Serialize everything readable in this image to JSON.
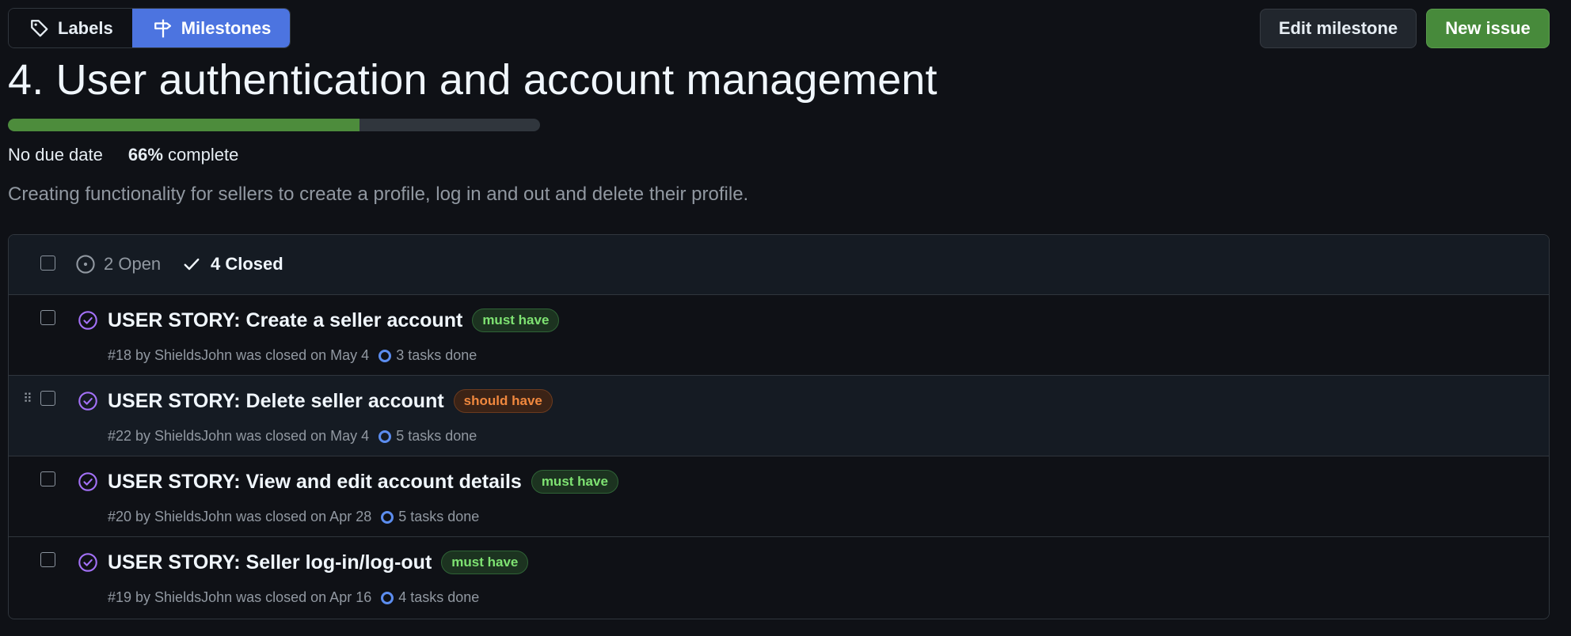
{
  "nav": {
    "labels_label": "Labels",
    "milestones_label": "Milestones"
  },
  "actions": {
    "edit_label": "Edit milestone",
    "new_issue_label": "New issue"
  },
  "milestone": {
    "title": "4. User authentication and account management",
    "progress_fraction": 0.66,
    "due": "No due date",
    "percent": "66%",
    "complete_word": " complete",
    "description": "Creating functionality for sellers to create a profile, log in and out and delete their profile."
  },
  "states": {
    "open_label": "2 Open",
    "closed_label": "4 Closed"
  },
  "issues": [
    {
      "title": "USER STORY: Create a seller account",
      "label": "must have",
      "label_color": "green",
      "meta": "#18 by ShieldsJohn was closed on May 4",
      "tasks": "3 tasks done"
    },
    {
      "title": "USER STORY: Delete seller account",
      "label": "should have",
      "label_color": "orange",
      "meta": "#22 by ShieldsJohn was closed on May 4",
      "tasks": "5 tasks done"
    },
    {
      "title": "USER STORY: View and edit account details",
      "label": "must have",
      "label_color": "green",
      "meta": "#20 by ShieldsJohn was closed on Apr 28",
      "tasks": "5 tasks done"
    },
    {
      "title": "USER STORY: Seller log-in/log-out",
      "label": "must have",
      "label_color": "green",
      "meta": "#19 by ShieldsJohn was closed on Apr 16",
      "tasks": "4 tasks done"
    }
  ],
  "colors": {
    "accent": "#4c74e0",
    "primary_button": "#478a3b",
    "progress_fill": "#4d8c3c",
    "closed_icon": "#a371f7",
    "task_ring": "#5c8def"
  }
}
